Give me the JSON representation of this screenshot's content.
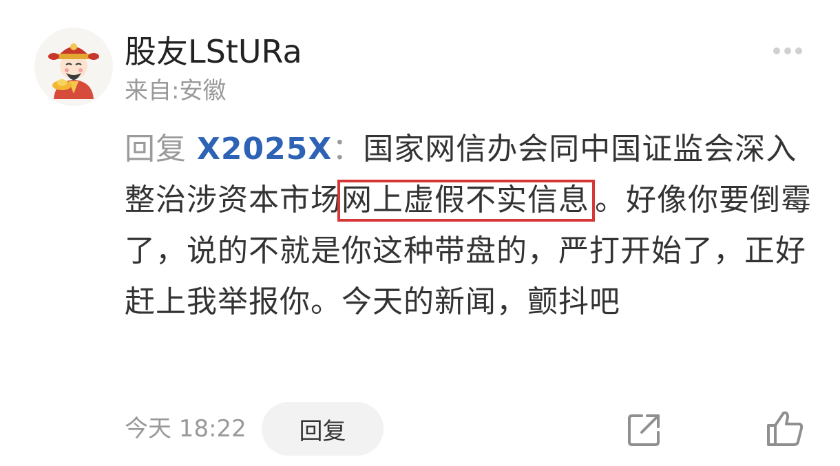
{
  "post": {
    "username": "股友LStURa",
    "location": "来自:安徽",
    "avatar_icon": "god-of-wealth-avatar-icon",
    "more_icon": "more-dots-icon"
  },
  "comment": {
    "reply_prefix": "回复",
    "mention": "X2025X",
    "colon": "：",
    "text_before_highlight": "国家网信办会同中国证监会深入整治涉资本市场",
    "highlighted_text": "网上虚假不实信息",
    "text_after_highlight": "。好像你要倒霉了，说的不就是你这种带盘的，严打开始了，正好赶上我举报你。今天的新闻，颤抖吧",
    "highlight_color": "#d63636",
    "mention_color": "#2d62b5"
  },
  "footer": {
    "timestamp": "今天 18:22",
    "reply_button_label": "回复",
    "share_icon": "share-icon",
    "like_icon": "thumbs-up-icon"
  }
}
